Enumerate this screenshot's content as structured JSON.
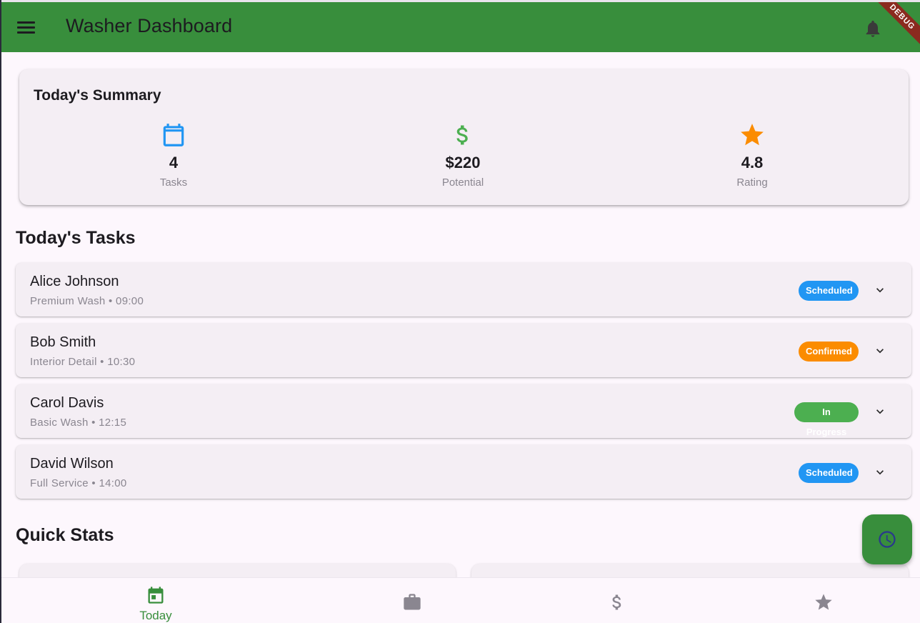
{
  "colors": {
    "appbar": "#388e3c",
    "calendar_icon": "#2196f3",
    "dollar_icon": "#4caf50",
    "star_icon": "#fb8c00",
    "scheduled": "#2196f3",
    "confirmed": "#fb8c00",
    "in_progress": "#4caf50",
    "nav_active": "#388e3c",
    "nav_inactive": "#8a8690"
  },
  "appbar": {
    "title": "Washer Dashboard",
    "menu_icon": "menu-icon",
    "notification_icon": "bell-icon",
    "debug_banner": "DEBUG"
  },
  "summary": {
    "title": "Today's Summary",
    "stats": [
      {
        "icon": "calendar-icon",
        "value": "4",
        "label": "Tasks"
      },
      {
        "icon": "dollar-icon",
        "value": "$220",
        "label": "Potential"
      },
      {
        "icon": "star-icon",
        "value": "4.8",
        "label": "Rating"
      }
    ]
  },
  "tasks_section": {
    "title": "Today's Tasks",
    "tasks": [
      {
        "name": "Alice Johnson",
        "detail": "Premium Wash • 09:00",
        "status": "Scheduled"
      },
      {
        "name": "Bob Smith",
        "detail": "Interior Detail • 10:30",
        "status": "Confirmed"
      },
      {
        "name": "Carol Davis",
        "detail": "Basic Wash • 12:15",
        "status": "In Progress"
      },
      {
        "name": "David Wilson",
        "detail": "Full Service • 14:00",
        "status": "Scheduled"
      }
    ]
  },
  "quick_stats": {
    "title": "Quick Stats"
  },
  "fab": {
    "icon": "clock-icon"
  },
  "bottom_nav": {
    "items": [
      {
        "label": "Today",
        "icon": "calendar-today-icon",
        "active": true
      },
      {
        "label": "",
        "icon": "briefcase-icon",
        "active": false
      },
      {
        "label": "",
        "icon": "dollar-icon",
        "active": false
      },
      {
        "label": "",
        "icon": "star-icon",
        "active": false
      }
    ]
  }
}
